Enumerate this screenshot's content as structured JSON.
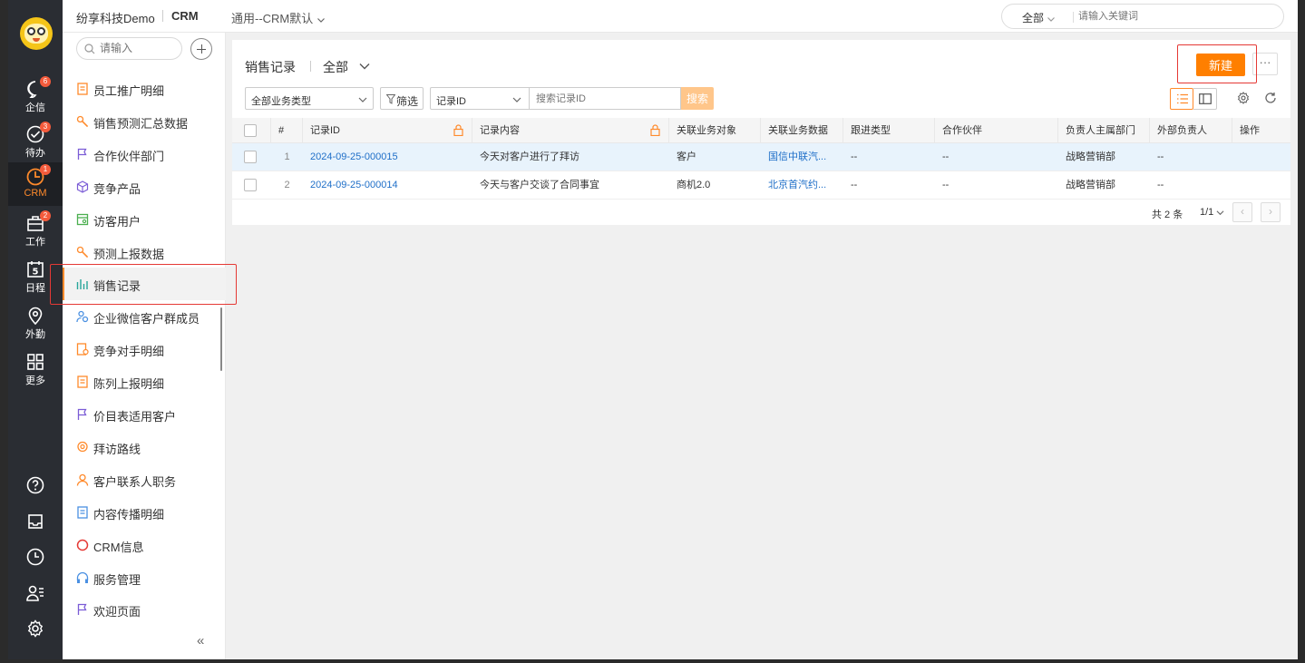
{
  "topbar": {
    "company": "纷享科技Demo",
    "app": "CRM",
    "workspace": "通用--CRM默认",
    "search_scope": "全部",
    "search_placeholder": "请输入关键词"
  },
  "leftnav": {
    "items": [
      {
        "label": "企信",
        "badge": "6",
        "icon": "chat-icon"
      },
      {
        "label": "待办",
        "badge": "3",
        "icon": "check-circle-icon"
      },
      {
        "label": "CRM",
        "badge": "1",
        "icon": "crm-icon",
        "active": true
      },
      {
        "label": "工作",
        "badge": "2",
        "icon": "briefcase-icon"
      },
      {
        "label": "日程",
        "icon": "calendar-icon",
        "calendar_day": "5"
      },
      {
        "label": "外勤",
        "icon": "location-icon"
      },
      {
        "label": "更多",
        "icon": "grid-icon"
      }
    ]
  },
  "menu": {
    "search_placeholder": "请输入",
    "items": [
      {
        "label": "员工推广明细",
        "icon": "doc-icon",
        "color": "#ff8a2b"
      },
      {
        "label": "销售预测汇总数据",
        "icon": "wrench-icon",
        "color": "#ff8a2b"
      },
      {
        "label": "合作伙伴部门",
        "icon": "flag-icon",
        "color": "#7b5cd6"
      },
      {
        "label": "竞争产品",
        "icon": "cube-icon",
        "color": "#7b5cd6"
      },
      {
        "label": "访客用户",
        "icon": "id-card-icon",
        "color": "#4caf50"
      },
      {
        "label": "预测上报数据",
        "icon": "wrench-icon",
        "color": "#ff8a2b"
      },
      {
        "label": "销售记录",
        "icon": "chart-icon",
        "color": "#26a69a",
        "active": true
      },
      {
        "label": "企业微信客户群成员",
        "icon": "user-gear-icon",
        "color": "#4a90e2"
      },
      {
        "label": "竞争对手明细",
        "icon": "doc-gear-icon",
        "color": "#ff8a2b"
      },
      {
        "label": "陈列上报明细",
        "icon": "doc-icon",
        "color": "#ff8a2b"
      },
      {
        "label": "价目表适用客户",
        "icon": "flag-icon",
        "color": "#7b5cd6"
      },
      {
        "label": "拜访路线",
        "icon": "pin-icon",
        "color": "#ff8a2b"
      },
      {
        "label": "客户联系人职务",
        "icon": "person-icon",
        "color": "#ff8a2b"
      },
      {
        "label": "内容传播明细",
        "icon": "doc-icon",
        "color": "#4a90e2"
      },
      {
        "label": "CRM信息",
        "icon": "crm-ring-icon",
        "color": "#e53935"
      },
      {
        "label": "服务管理",
        "icon": "headset-icon",
        "color": "#4a90e2"
      },
      {
        "label": "欢迎页面",
        "icon": "flag-icon",
        "color": "#7b5cd6"
      }
    ]
  },
  "page": {
    "title": "销售记录",
    "scope": "全部",
    "new_label": "新建",
    "more_label": "···",
    "type_filter": "全部业务类型",
    "filter_label": "筛选",
    "field_select": "记录ID",
    "keyword_placeholder": "搜索记录ID",
    "search_label": "搜索"
  },
  "table": {
    "columns": [
      "#",
      "记录ID",
      "记录内容",
      "关联业务对象",
      "关联业务数据",
      "跟进类型",
      "合作伙伴",
      "负责人主属部门",
      "外部负责人",
      "操作"
    ],
    "rows": [
      {
        "idx": "1",
        "id": "2024-09-25-000015",
        "content": "今天对客户进行了拜访",
        "object": "客户",
        "data": "国信中联汽...",
        "type": "--",
        "partner": "--",
        "dept": "战略营销部",
        "external": "--",
        "selected": true
      },
      {
        "idx": "2",
        "id": "2024-09-25-000014",
        "content": "今天与客户交谈了合同事宜",
        "object": "商机2.0",
        "data": "北京首汽约...",
        "type": "--",
        "partner": "--",
        "dept": "战略营销部",
        "external": "--",
        "selected": false
      }
    ]
  },
  "pager": {
    "total": "共 2 条",
    "page": "1/1"
  },
  "colors": {
    "accent": "#ff7f00",
    "link": "#1f6fc8",
    "nav_bg": "#2a2d33",
    "highlight": "#e53935"
  }
}
